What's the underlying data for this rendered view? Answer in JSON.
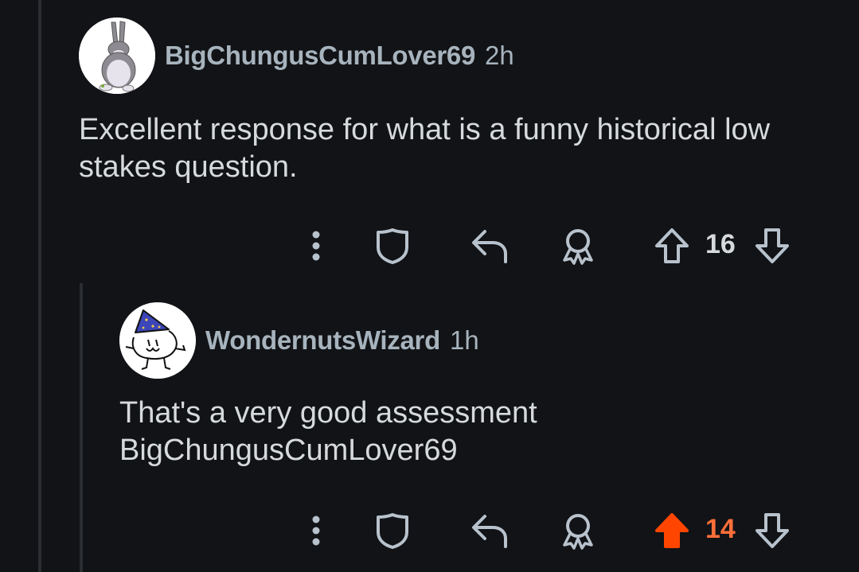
{
  "comments": [
    {
      "username": "BigChungusCumLover69",
      "timestamp": "2h",
      "text": "Excellent response for what is a funny historical low stakes question.",
      "votes": "16",
      "upvoted": false,
      "avatar_icon": "big-chungus-avatar"
    },
    {
      "username": "WondernutsWizard",
      "timestamp": "1h",
      "text": "That's a very good assessment BigChungusCumLover69",
      "votes": "14",
      "upvoted": true,
      "avatar_icon": "wizard-doodle-avatar"
    }
  ],
  "icons": {
    "more": "more-vertical-icon",
    "moderate": "shield-icon",
    "reply": "reply-icon",
    "award": "award-icon",
    "upvote": "upvote-icon",
    "downvote": "downvote-icon"
  },
  "colors": {
    "background": "#111316",
    "username": "#a7b3bd",
    "body": "#d7dadc",
    "icon": "#b8c2cc",
    "upvote_active": "#ff4500",
    "upvote_count_active": "#ff6f3a"
  }
}
